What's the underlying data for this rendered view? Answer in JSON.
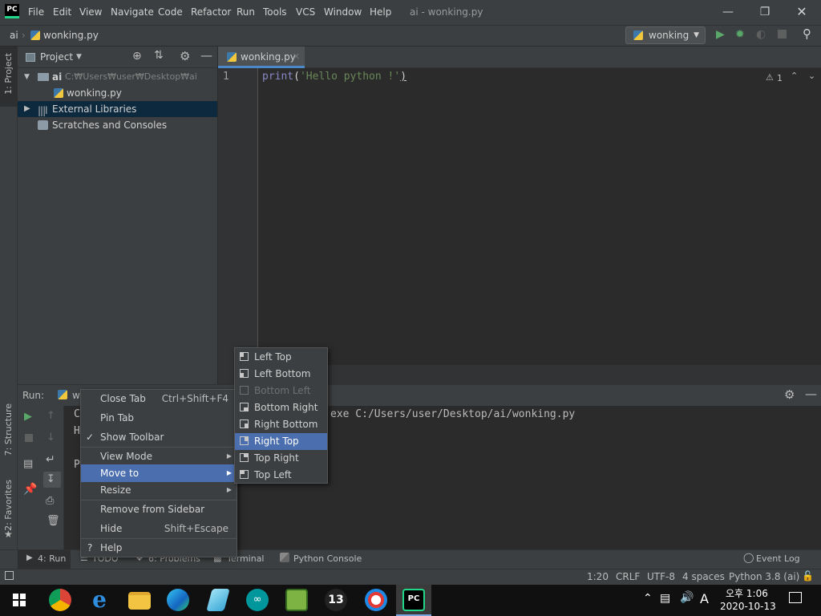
{
  "titlebar": {
    "logo": "PC",
    "menu": [
      "File",
      "Edit",
      "View",
      "Navigate",
      "Code",
      "Refactor",
      "Run",
      "Tools",
      "VCS",
      "Window",
      "Help"
    ],
    "window_title": "ai - wonking.py"
  },
  "navbar": {
    "breadcrumb_root": "ai",
    "breadcrumb_file": "wonking.py",
    "run_config": "wonking"
  },
  "left_strip": {
    "project": "1: Project",
    "structure": "7: Structure",
    "favorites": "2: Favorites"
  },
  "project": {
    "title": "Project",
    "tree": [
      {
        "label": "ai",
        "path": "C:₩Users₩user₩Desktop₩ai"
      },
      {
        "label": "wonking.py"
      },
      {
        "label": "External Libraries"
      },
      {
        "label": "Scratches and Consoles"
      }
    ]
  },
  "editor": {
    "tab": "wonking.py",
    "line_number": "1",
    "code_fn": "print",
    "code_open": "(",
    "code_str": "'Hello python !'",
    "code_close": ")",
    "warnings": "1"
  },
  "run": {
    "label": "Run:",
    "tab_label": "w",
    "console_partial": [
      "C",
      "H",
      "P"
    ],
    "console_line": "exe C:/Users/user/Desktop/ai/wonking.py"
  },
  "context_menu": {
    "items": [
      {
        "label": "Close Tab",
        "shortcut": "Ctrl+Shift+F4"
      },
      {
        "label": "Pin Tab"
      },
      {
        "label": "Show Toolbar",
        "checked": true
      },
      {
        "label": "View Mode"
      },
      {
        "label": "Move to",
        "active": true
      },
      {
        "label": "Resize"
      },
      {
        "label": "Remove from Sidebar"
      },
      {
        "label": "Hide",
        "shortcut": "Shift+Escape"
      },
      {
        "label": "Help"
      }
    ]
  },
  "submenu": {
    "items": [
      {
        "label": "Left Top"
      },
      {
        "label": "Left Bottom"
      },
      {
        "label": "Bottom Left",
        "disabled": true
      },
      {
        "label": "Bottom Right"
      },
      {
        "label": "Right Bottom"
      },
      {
        "label": "Right Top",
        "active": true
      },
      {
        "label": "Top Right"
      },
      {
        "label": "Top Left"
      }
    ]
  },
  "bottom_tools": {
    "run": "4: Run",
    "todo": "TODO",
    "problems": "6: Problems",
    "terminal": "Terminal",
    "python_console": "Python Console",
    "event_log": "Event Log"
  },
  "status": {
    "position": "1:20",
    "line_sep": "CRLF",
    "encoding": "UTF-8",
    "indent": "4 spaces",
    "interpreter": "Python 3.8 (ai)"
  },
  "taskbar": {
    "time": "오후 1:06",
    "date": "2020-10-13",
    "ime": "A"
  },
  "colors": {
    "accent": "#4b6eaf",
    "selection": "#0d293e",
    "code_fn": "#8888c6",
    "code_str": "#6a8759",
    "run_green": "#59a869"
  }
}
